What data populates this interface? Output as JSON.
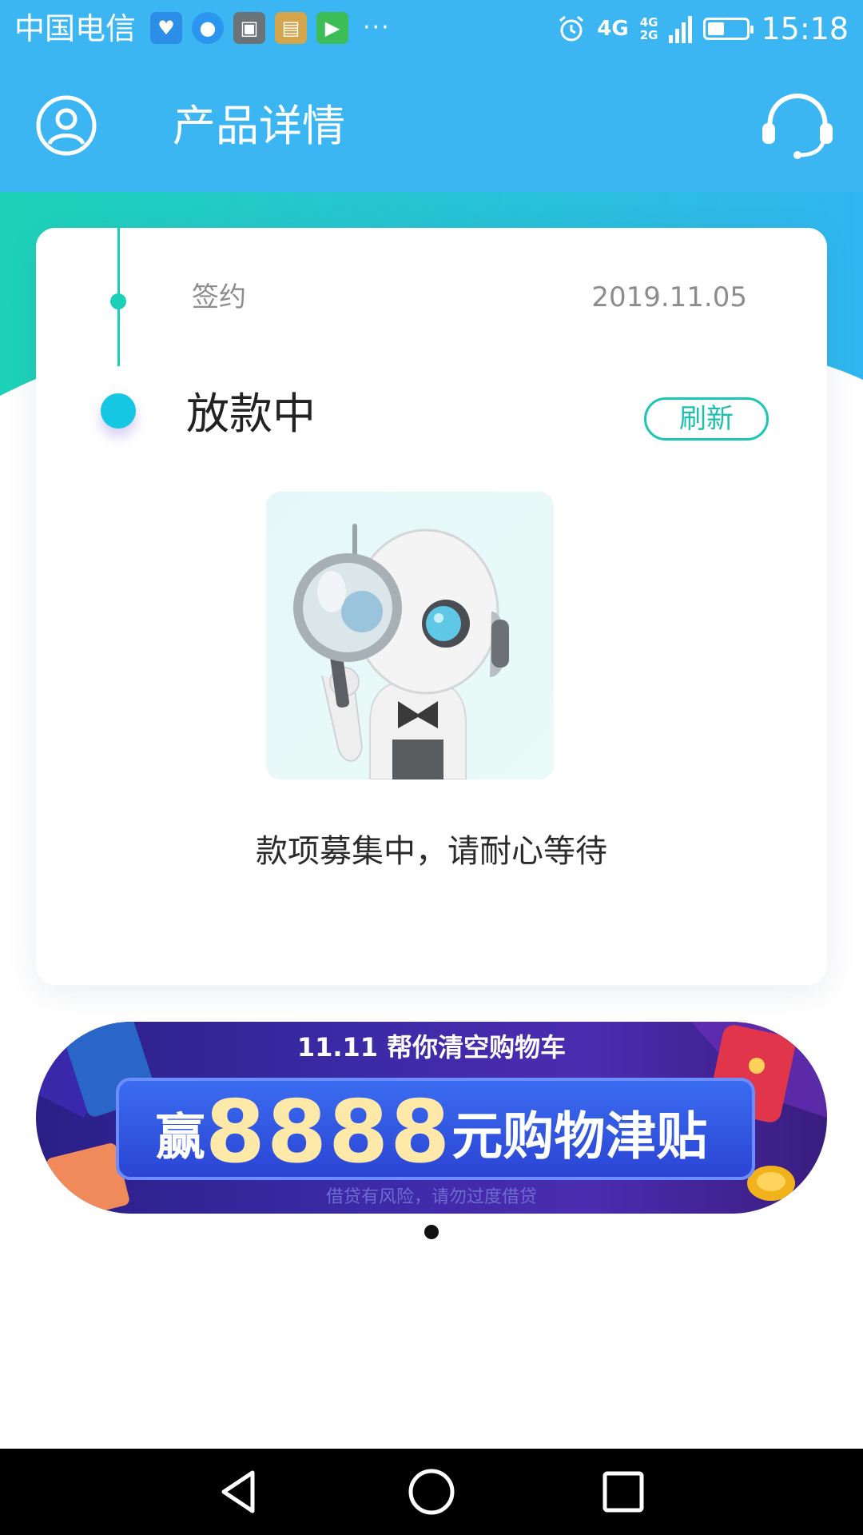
{
  "status_bar": {
    "carrier": "中国电信",
    "notification_icons": [
      "health-app-icon",
      "message-app-icon",
      "photo-app-icon",
      "wallet-app-icon",
      "video-app-icon"
    ],
    "more_indicator": "···",
    "network_4g": "4G",
    "network_secondary_top": "4G",
    "network_secondary_bottom": "2G",
    "time": "15:18",
    "battery_level": 0.45
  },
  "header": {
    "title": "产品详情",
    "left_icon": "user-avatar-icon",
    "right_icon": "customer-service-icon"
  },
  "progress": {
    "steps": [
      {
        "label": "签约",
        "date": "2019.11.05"
      },
      {
        "label": "放款中"
      }
    ],
    "refresh_label": "刷新",
    "waiting_message": "款项募集中，请耐心等待"
  },
  "banner": {
    "top_text": "11.11 帮你清空购物车",
    "win_text": "赢",
    "amount": "8888",
    "rest_text": "元购物津贴",
    "note": "借贷有风险，请勿过度借贷"
  },
  "colors": {
    "header_blue": "#3bb6f3",
    "accent_teal": "#1bd0b9",
    "dot_cyan": "#16c7e3"
  }
}
